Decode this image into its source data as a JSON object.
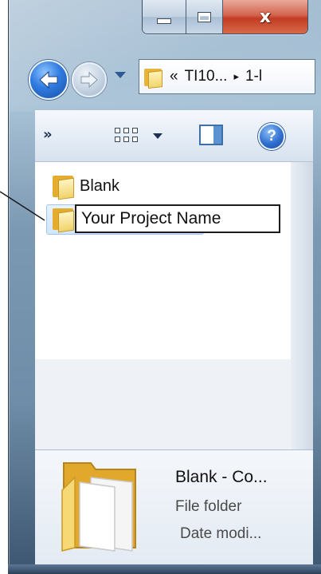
{
  "window": {
    "caption": {
      "minimize": "minimize",
      "maximize": "maximize",
      "close_glyph": "x"
    }
  },
  "nav": {
    "back_icon": "back-arrow-icon",
    "forward_icon": "forward-arrow-icon",
    "address": {
      "prefix": "«",
      "segment1": "TI10...",
      "arrow": "▸",
      "segment2": "1-l"
    }
  },
  "toolbar": {
    "more": "»",
    "views_icon": "views-icon",
    "preview_icon": "preview-pane-icon",
    "help": "?"
  },
  "files": [
    {
      "name": "Blank"
    }
  ],
  "rename": {
    "value": "Your Project Name"
  },
  "details": {
    "name": "Blank - Co...",
    "type": "File folder",
    "date": "Date modi..."
  },
  "colors": {
    "frame": "#7c99b3",
    "close": "#c23c22",
    "selection": "#d2e6fb",
    "folder": "#e5ac2e"
  }
}
